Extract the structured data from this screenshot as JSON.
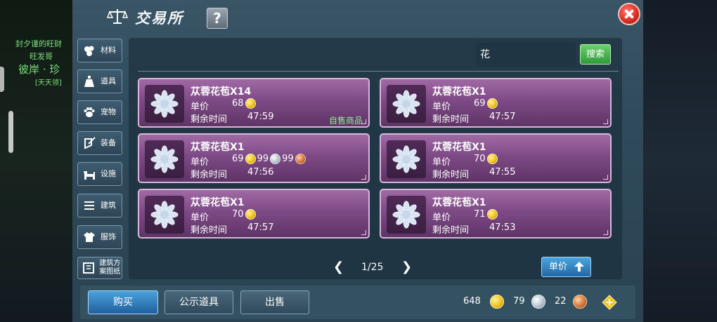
{
  "background": {
    "left_texts": [
      "封夕谨的旺财",
      "旺发哥",
      "彼岸 · 珍",
      "[天天领]"
    ]
  },
  "header": {
    "title": "交易所",
    "help_label": "?"
  },
  "categories": [
    {
      "label": "材料",
      "icon": "material-icon"
    },
    {
      "label": "道具",
      "icon": "item-icon"
    },
    {
      "label": "宠物",
      "icon": "pet-icon"
    },
    {
      "label": "装备",
      "icon": "equipment-icon"
    },
    {
      "label": "设施",
      "icon": "facility-icon"
    },
    {
      "label": "建筑",
      "icon": "building-icon"
    },
    {
      "label": "服饰",
      "icon": "clothing-icon"
    },
    {
      "label": "建筑方案图纸",
      "icon": "blueprint-icon"
    }
  ],
  "search": {
    "value": "花",
    "button_label": "搜索"
  },
  "listings": [
    {
      "name": "苁蓉花苞X14",
      "price_label": "单价",
      "time_label": "剩余时间",
      "time": "47:59",
      "prices": [
        {
          "amount": "68",
          "currency": "gold"
        }
      ],
      "self_sale": "自售商品"
    },
    {
      "name": "苁蓉花苞X1",
      "price_label": "单价",
      "time_label": "剩余时间",
      "time": "47:57",
      "prices": [
        {
          "amount": "69",
          "currency": "gold"
        }
      ],
      "self_sale": ""
    },
    {
      "name": "苁蓉花苞X1",
      "price_label": "单价",
      "time_label": "剩余时间",
      "time": "47:56",
      "prices": [
        {
          "amount": "69",
          "currency": "gold"
        },
        {
          "amount": "99",
          "currency": "silver"
        },
        {
          "amount": "99",
          "currency": "bronze"
        }
      ],
      "self_sale": ""
    },
    {
      "name": "苁蓉花苞X1",
      "price_label": "单价",
      "time_label": "剩余时间",
      "time": "47:55",
      "prices": [
        {
          "amount": "70",
          "currency": "gold"
        }
      ],
      "self_sale": ""
    },
    {
      "name": "苁蓉花苞X1",
      "price_label": "单价",
      "time_label": "剩余时间",
      "time": "47:57",
      "prices": [
        {
          "amount": "70",
          "currency": "gold"
        }
      ],
      "self_sale": ""
    },
    {
      "name": "苁蓉花苞X1",
      "price_label": "单价",
      "time_label": "剩余时间",
      "time": "47:53",
      "prices": [
        {
          "amount": "71",
          "currency": "gold"
        }
      ],
      "self_sale": ""
    }
  ],
  "pagination": {
    "text": "1/25"
  },
  "sort": {
    "label": "单价"
  },
  "actions": {
    "buy": "购买",
    "public": "公示道具",
    "sell": "出售"
  },
  "currency": {
    "gold": "648",
    "silver": "79",
    "bronze": "22"
  },
  "colors": {
    "gold": "#f2c21b",
    "silver": "#b9c6d0",
    "bronze": "#d2773a",
    "card": "#7e4a86",
    "search_button": "#2f9a3a",
    "buy_button": "#215f9e",
    "close_button": "#d4241b"
  }
}
